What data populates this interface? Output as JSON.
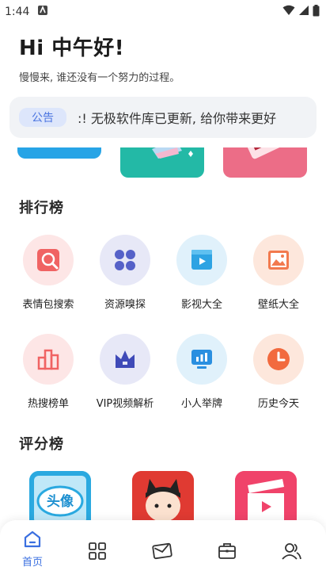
{
  "status_bar": {
    "time": "1:44"
  },
  "greeting": {
    "title": "Hi 中午好!",
    "subtitle": "慢慢来, 谁还没有一个努力的过程。"
  },
  "notice": {
    "badge": "公告",
    "text": ":!     无极软件库已更新, 给你带来更好"
  },
  "sections": {
    "ranking_title": "排行榜",
    "rating_title": "评分榜"
  },
  "ranking_items": [
    {
      "label": "表情包搜索",
      "icon": "image-search-icon",
      "bg": "#fde6e6",
      "fg": "#f06363"
    },
    {
      "label": "资源嗅探",
      "icon": "grid-app-icon",
      "bg": "#e7e8f7",
      "fg": "#5561c8"
    },
    {
      "label": "影视大全",
      "icon": "video-icon",
      "bg": "#e0f1fb",
      "fg": "#2ea3e3"
    },
    {
      "label": "壁纸大全",
      "icon": "image-icon",
      "bg": "#fde7dc",
      "fg": "#f27a4e"
    },
    {
      "label": "热搜榜单",
      "icon": "chart-bars-icon",
      "bg": "#fde6e6",
      "fg": "#f06363"
    },
    {
      "label": "VIP视频解析",
      "icon": "crown-icon",
      "bg": "#e7e8f7",
      "fg": "#3f4ab8"
    },
    {
      "label": "小人举牌",
      "icon": "sign-board-icon",
      "bg": "#e0f1fb",
      "fg": "#2a8fe0"
    },
    {
      "label": "历史今天",
      "icon": "clock-icon",
      "bg": "#fde7dc",
      "fg": "#f26a3e"
    }
  ],
  "rating_cards": [
    {
      "label": "头像",
      "icon": "avatar-app-icon"
    },
    {
      "icon": "cartoon-app-icon"
    },
    {
      "icon": "video-clapper-app-icon"
    }
  ],
  "bottom_nav": [
    {
      "label": "首页",
      "icon": "home-icon",
      "active": true
    },
    {
      "icon": "apps-grid-icon"
    },
    {
      "icon": "mail-icon"
    },
    {
      "icon": "briefcase-icon"
    },
    {
      "icon": "users-icon"
    }
  ],
  "colors": {
    "accent": "#3a6fe0",
    "nav_inactive": "#333333"
  }
}
